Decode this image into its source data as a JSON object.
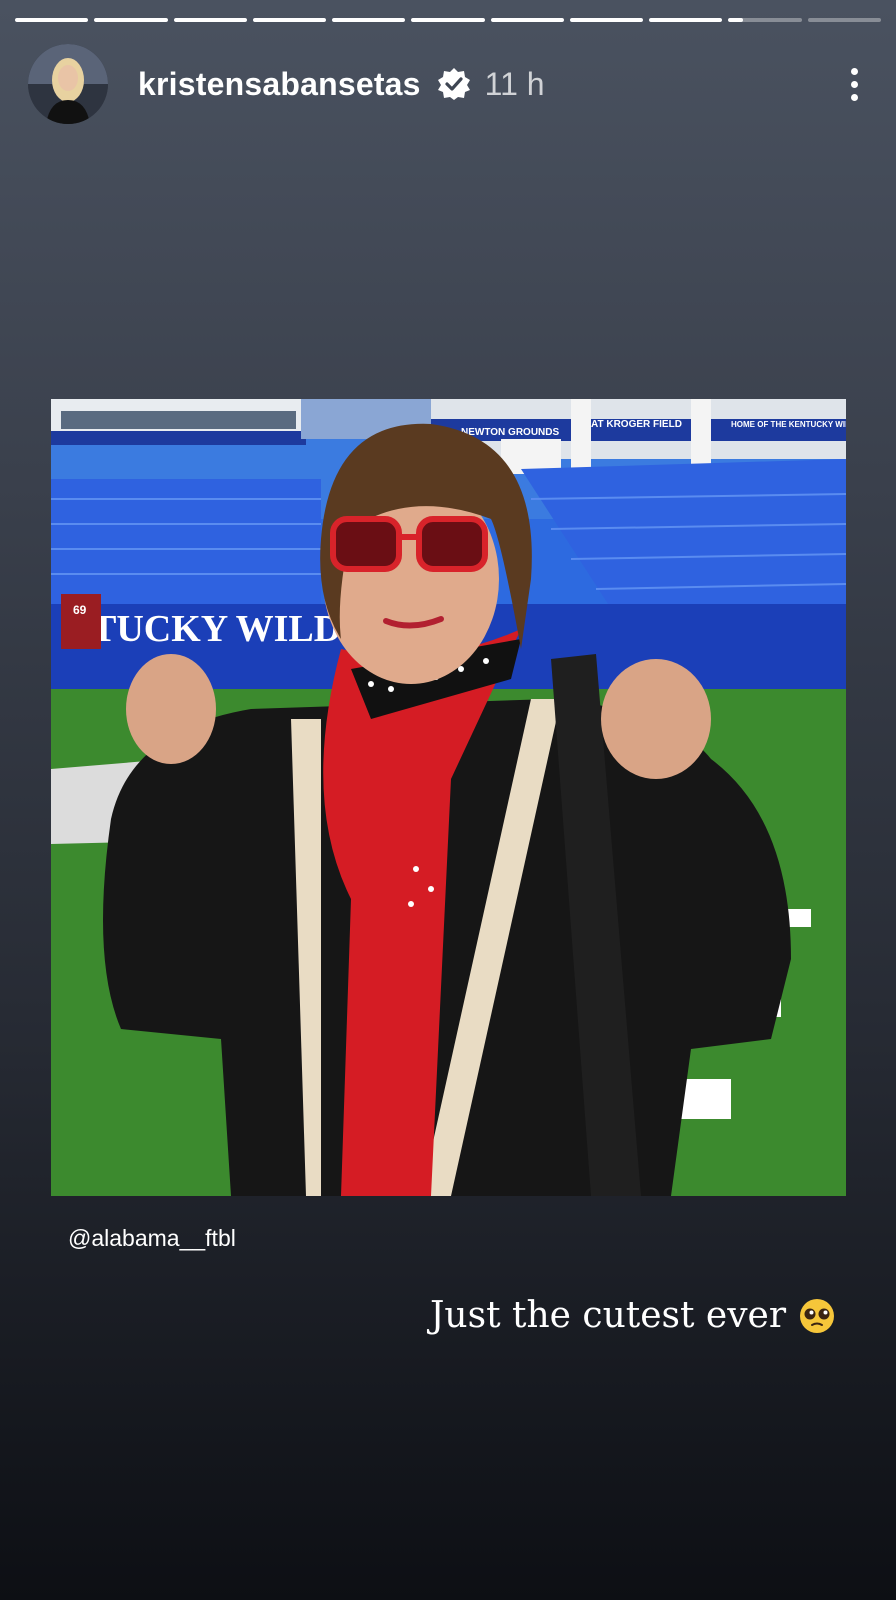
{
  "story": {
    "progress": [
      1,
      1,
      1,
      1,
      1,
      1,
      1,
      1,
      1,
      0.2,
      0
    ],
    "user": {
      "username": "kristensabansetas",
      "verified": true,
      "time_ago": "11 h"
    },
    "icons": {
      "verified": "verified-badge-icon",
      "more": "more-options-icon",
      "emoji": "pleading-face-emoji"
    },
    "photo": {
      "stadium_banner": "TUCKY WILDCA",
      "banner_newton": "NEWTON GROUNDS",
      "banner_kroger": "AT KROGER FIELD",
      "banner_home": "HOME OF THE KENTUCKY WILDCATS",
      "jersey_number": "69"
    },
    "mention": "@alabama__ftbl",
    "caption": "Just the cutest ever"
  }
}
